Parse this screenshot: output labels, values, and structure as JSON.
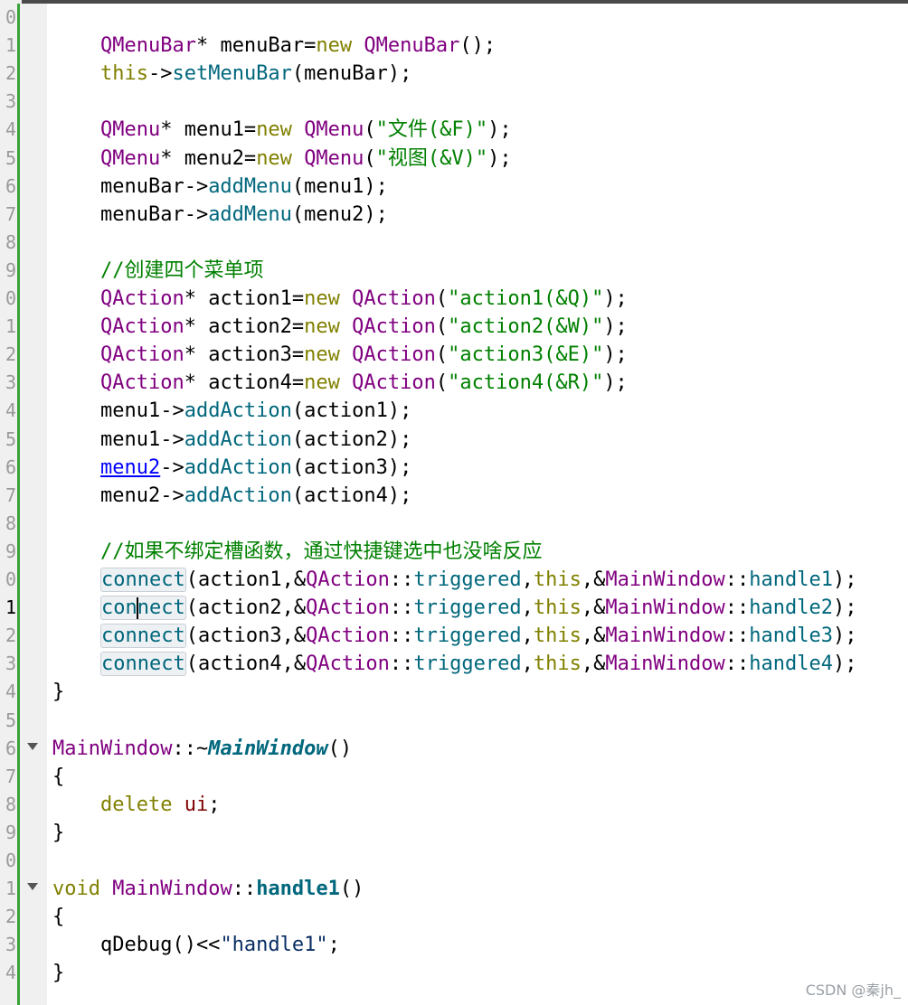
{
  "editor": {
    "lines": [
      {
        "number": "0"
      },
      {
        "number": "1",
        "tokens": [
          {
            "t": "    "
          },
          {
            "t": "QMenuBar",
            "c": "type"
          },
          {
            "t": "* menuBar="
          },
          {
            "t": "new",
            "c": "kw"
          },
          {
            "t": " "
          },
          {
            "t": "QMenuBar",
            "c": "type"
          },
          {
            "t": "();"
          }
        ]
      },
      {
        "number": "2",
        "tokens": [
          {
            "t": "    "
          },
          {
            "t": "this",
            "c": "kw"
          },
          {
            "t": "->"
          },
          {
            "t": "setMenuBar",
            "c": "fn"
          },
          {
            "t": "(menuBar);"
          }
        ]
      },
      {
        "number": "3"
      },
      {
        "number": "4",
        "tokens": [
          {
            "t": "    "
          },
          {
            "t": "QMenu",
            "c": "type"
          },
          {
            "t": "* menu1="
          },
          {
            "t": "new",
            "c": "kw"
          },
          {
            "t": " "
          },
          {
            "t": "QMenu",
            "c": "type"
          },
          {
            "t": "("
          },
          {
            "t": "\"文件(&F)\"",
            "c": "str"
          },
          {
            "t": ");"
          }
        ]
      },
      {
        "number": "5",
        "tokens": [
          {
            "t": "    "
          },
          {
            "t": "QMenu",
            "c": "type"
          },
          {
            "t": "* menu2="
          },
          {
            "t": "new",
            "c": "kw"
          },
          {
            "t": " "
          },
          {
            "t": "QMenu",
            "c": "type"
          },
          {
            "t": "("
          },
          {
            "t": "\"视图(&V)\"",
            "c": "str"
          },
          {
            "t": ");"
          }
        ]
      },
      {
        "number": "6",
        "tokens": [
          {
            "t": "    menuBar->"
          },
          {
            "t": "addMenu",
            "c": "fn"
          },
          {
            "t": "(menu1);"
          }
        ]
      },
      {
        "number": "7",
        "tokens": [
          {
            "t": "    menuBar->"
          },
          {
            "t": "addMenu",
            "c": "fn"
          },
          {
            "t": "(menu2);"
          }
        ]
      },
      {
        "number": "8",
        "changed": true
      },
      {
        "number": "9",
        "tokens": [
          {
            "t": "    "
          },
          {
            "t": "//创建四个菜单项",
            "c": "cm"
          }
        ]
      },
      {
        "number": "0",
        "tokens": [
          {
            "t": "    "
          },
          {
            "t": "QAction",
            "c": "type"
          },
          {
            "t": "* action1="
          },
          {
            "t": "new",
            "c": "kw"
          },
          {
            "t": " "
          },
          {
            "t": "QAction",
            "c": "type"
          },
          {
            "t": "("
          },
          {
            "t": "\"action1(&Q)\"",
            "c": "str"
          },
          {
            "t": ");"
          }
        ]
      },
      {
        "number": "1",
        "tokens": [
          {
            "t": "    "
          },
          {
            "t": "QAction",
            "c": "type"
          },
          {
            "t": "* action2="
          },
          {
            "t": "new",
            "c": "kw"
          },
          {
            "t": " "
          },
          {
            "t": "QAction",
            "c": "type"
          },
          {
            "t": "("
          },
          {
            "t": "\"action2(&W)\"",
            "c": "str"
          },
          {
            "t": ");"
          }
        ]
      },
      {
        "number": "2",
        "tokens": [
          {
            "t": "    "
          },
          {
            "t": "QAction",
            "c": "type"
          },
          {
            "t": "* action3="
          },
          {
            "t": "new",
            "c": "kw"
          },
          {
            "t": " "
          },
          {
            "t": "QAction",
            "c": "type"
          },
          {
            "t": "("
          },
          {
            "t": "\"action3(&E)\"",
            "c": "str"
          },
          {
            "t": ");"
          }
        ]
      },
      {
        "number": "3",
        "tokens": [
          {
            "t": "    "
          },
          {
            "t": "QAction",
            "c": "type"
          },
          {
            "t": "* action4="
          },
          {
            "t": "new",
            "c": "kw"
          },
          {
            "t": " "
          },
          {
            "t": "QAction",
            "c": "type"
          },
          {
            "t": "("
          },
          {
            "t": "\"action4(&R)\"",
            "c": "str"
          },
          {
            "t": ");"
          }
        ]
      },
      {
        "number": "4",
        "tokens": [
          {
            "t": "    menu1->"
          },
          {
            "t": "addAction",
            "c": "fn"
          },
          {
            "t": "(action1);"
          }
        ]
      },
      {
        "number": "5",
        "tokens": [
          {
            "t": "    menu1->"
          },
          {
            "t": "addAction",
            "c": "fn"
          },
          {
            "t": "(action2);"
          }
        ]
      },
      {
        "number": "6",
        "tokens": [
          {
            "t": "    "
          },
          {
            "t": "menu2",
            "c": "link"
          },
          {
            "t": "->"
          },
          {
            "t": "addAction",
            "c": "fn"
          },
          {
            "t": "(action3);"
          }
        ]
      },
      {
        "number": "7",
        "tokens": [
          {
            "t": "    menu2->"
          },
          {
            "t": "addAction",
            "c": "fn"
          },
          {
            "t": "(action4);"
          }
        ]
      },
      {
        "number": "8"
      },
      {
        "number": "9",
        "tokens": [
          {
            "t": "    "
          },
          {
            "t": "//如果不绑定槽函数，通过快捷键选中也没啥反应",
            "c": "cm"
          }
        ]
      },
      {
        "number": "0",
        "tokens": [
          {
            "t": "    "
          },
          {
            "t": "connect",
            "c": "fn hl"
          },
          {
            "t": "(action1,&"
          },
          {
            "t": "QAction",
            "c": "type"
          },
          {
            "t": "::"
          },
          {
            "t": "triggered",
            "c": "fn"
          },
          {
            "t": ","
          },
          {
            "t": "this",
            "c": "kw"
          },
          {
            "t": ",&"
          },
          {
            "t": "MainWindow",
            "c": "type"
          },
          {
            "t": "::"
          },
          {
            "t": "handle1",
            "c": "fn"
          },
          {
            "t": ");"
          }
        ]
      },
      {
        "number": "1",
        "current": true,
        "tokens": [
          {
            "t": "    "
          },
          {
            "t": "connect",
            "c": "fn hl caret3"
          },
          {
            "t": "(action2,&"
          },
          {
            "t": "QAction",
            "c": "type"
          },
          {
            "t": "::"
          },
          {
            "t": "triggered",
            "c": "fn"
          },
          {
            "t": ","
          },
          {
            "t": "this",
            "c": "kw"
          },
          {
            "t": ",&"
          },
          {
            "t": "MainWindow",
            "c": "type"
          },
          {
            "t": "::"
          },
          {
            "t": "handle2",
            "c": "fn"
          },
          {
            "t": ");"
          }
        ]
      },
      {
        "number": "2",
        "tokens": [
          {
            "t": "    "
          },
          {
            "t": "connect",
            "c": "fn hl"
          },
          {
            "t": "(action3,&"
          },
          {
            "t": "QAction",
            "c": "type"
          },
          {
            "t": "::"
          },
          {
            "t": "triggered",
            "c": "fn"
          },
          {
            "t": ","
          },
          {
            "t": "this",
            "c": "kw"
          },
          {
            "t": ",&"
          },
          {
            "t": "MainWindow",
            "c": "type"
          },
          {
            "t": "::"
          },
          {
            "t": "handle3",
            "c": "fn"
          },
          {
            "t": ");"
          }
        ]
      },
      {
        "number": "3",
        "tokens": [
          {
            "t": "    "
          },
          {
            "t": "connect",
            "c": "fn hl"
          },
          {
            "t": "(action4,&"
          },
          {
            "t": "QAction",
            "c": "type"
          },
          {
            "t": "::"
          },
          {
            "t": "triggered",
            "c": "fn"
          },
          {
            "t": ","
          },
          {
            "t": "this",
            "c": "kw"
          },
          {
            "t": ",&"
          },
          {
            "t": "MainWindow",
            "c": "type"
          },
          {
            "t": "::"
          },
          {
            "t": "handle4",
            "c": "fn"
          },
          {
            "t": ");"
          }
        ]
      },
      {
        "number": "4",
        "tokens": [
          {
            "t": "}"
          }
        ]
      },
      {
        "number": "5"
      },
      {
        "number": "6",
        "fold": true,
        "tokens": [
          {
            "t": "MainWindow",
            "c": "type"
          },
          {
            "t": "::~"
          },
          {
            "t": "MainWindow",
            "c": "def"
          },
          {
            "t": "()"
          }
        ]
      },
      {
        "number": "7",
        "tokens": [
          {
            "t": "{"
          }
        ]
      },
      {
        "number": "8",
        "changed": true,
        "tokens": [
          {
            "t": "    "
          },
          {
            "t": "delete",
            "c": "kw"
          },
          {
            "t": " "
          },
          {
            "t": "ui",
            "c": "mem"
          },
          {
            "t": ";"
          }
        ]
      },
      {
        "number": "9",
        "tokens": [
          {
            "t": "}"
          }
        ]
      },
      {
        "number": "0"
      },
      {
        "number": "1",
        "fold": true,
        "tokens": [
          {
            "t": "void",
            "c": "kw"
          },
          {
            "t": " "
          },
          {
            "t": "MainWindow",
            "c": "type"
          },
          {
            "t": "::"
          },
          {
            "t": "handle1",
            "c": "defb"
          },
          {
            "t": "()"
          }
        ]
      },
      {
        "number": "2",
        "tokens": [
          {
            "t": "{"
          }
        ]
      },
      {
        "number": "3",
        "tokens": [
          {
            "t": "    qDebug()<<"
          },
          {
            "t": "\"handle1\"",
            "c": "var"
          },
          {
            "t": ";"
          }
        ]
      },
      {
        "number": "4",
        "tokens": [
          {
            "t": "}"
          }
        ]
      }
    ]
  },
  "watermark": "CSDN @秦jh_"
}
